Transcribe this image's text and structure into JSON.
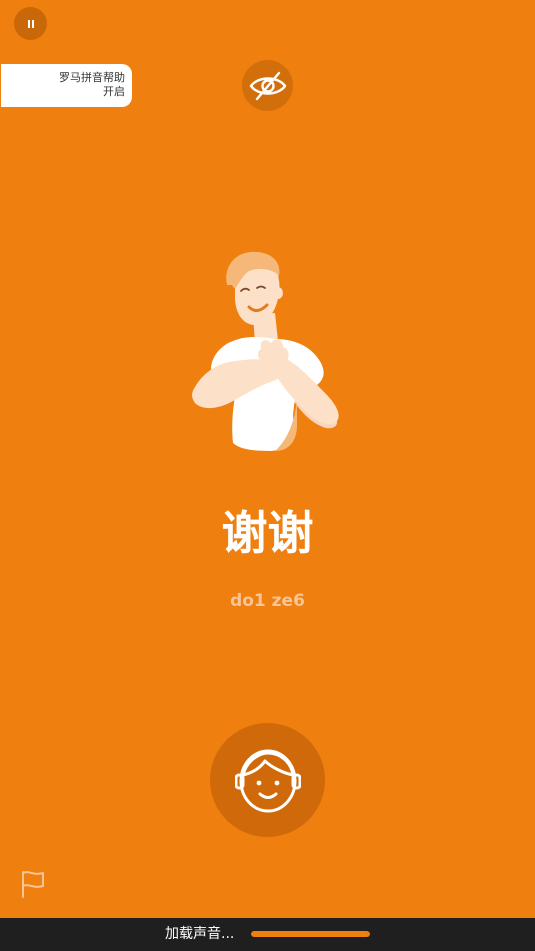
{
  "top": {
    "pause_icon": "pause-icon",
    "romanization_help": {
      "title": "罗马拼音帮助",
      "state": "开启"
    },
    "visibility_icon": "eye-off-icon"
  },
  "lesson": {
    "word": "谢谢",
    "romanization": "do1 ze6",
    "illustration": "person-thanking-illustration"
  },
  "controls": {
    "speaker_icon": "speaker-face-icon",
    "flag_icon": "flag-icon"
  },
  "loading": {
    "label": "加载声音...",
    "progress": 1.0
  },
  "colors": {
    "background": "#ef7f0e",
    "button_dark": "#d0690a",
    "romanization": "#f8c597",
    "loading_bar": "#1f1f1f"
  }
}
